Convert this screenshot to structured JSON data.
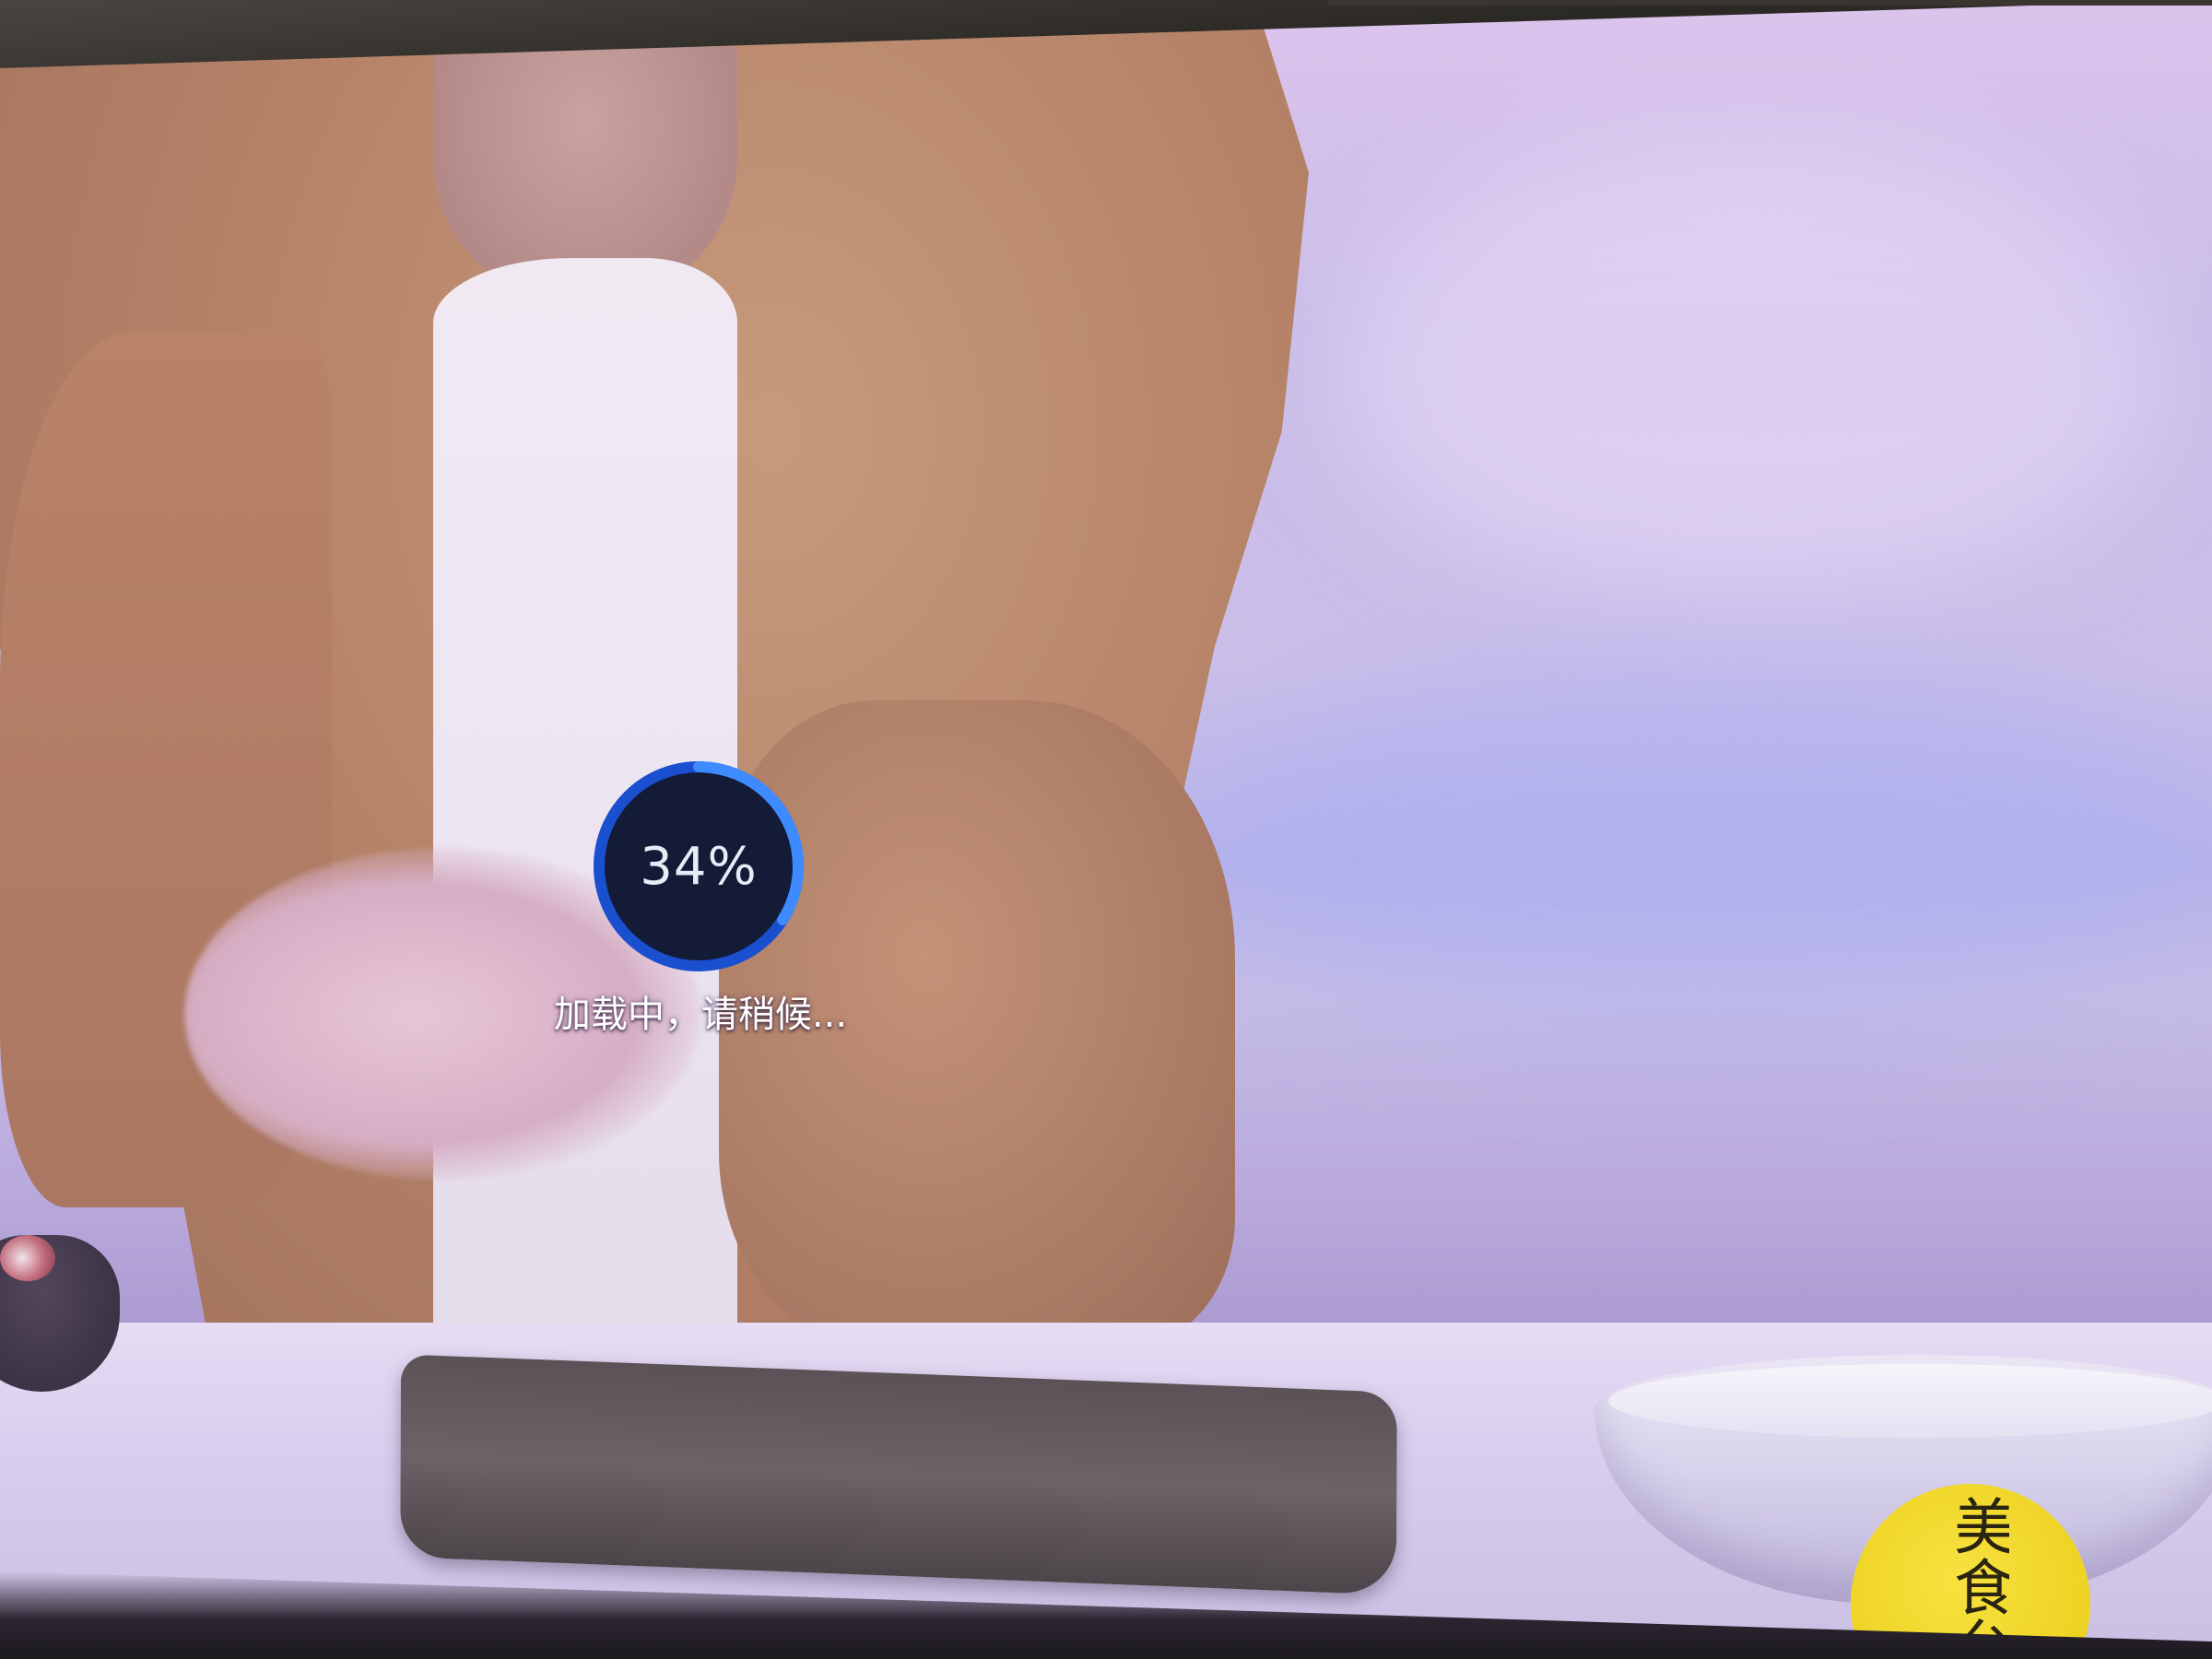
{
  "loading": {
    "percent_text": "34%",
    "progress": 0.34,
    "message": "加载中，请稍候..."
  },
  "channel_logo": {
    "text": "美食台"
  },
  "colors": {
    "ring_track": "#1a4fd0",
    "ring_progress": "#3d8bff",
    "ring_center": "#141b36",
    "logo_yellow": "#f2d92a"
  }
}
